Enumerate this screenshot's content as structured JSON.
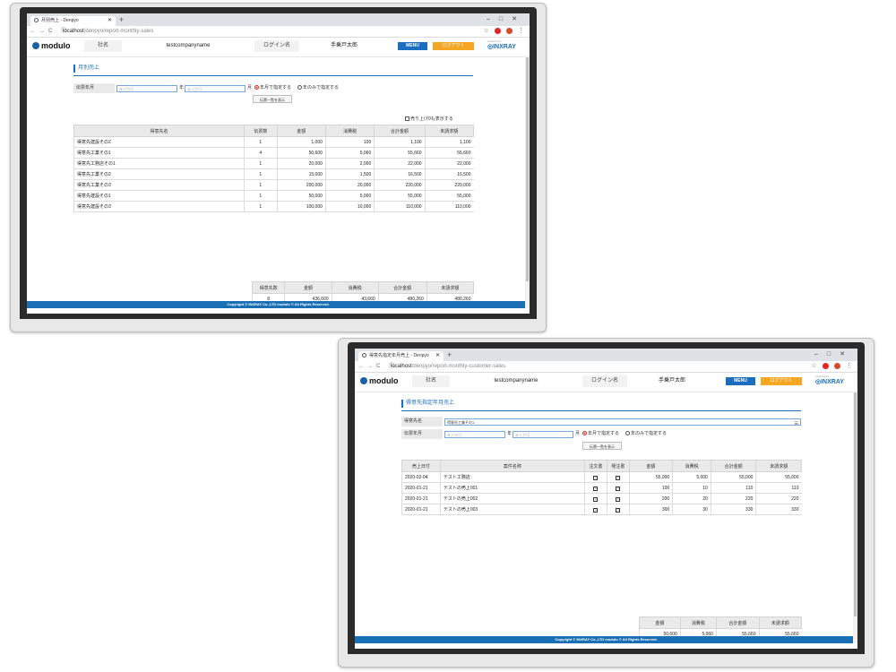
{
  "common": {
    "url_host": "localhost",
    "company_label": "社名",
    "company_value": "testcompanyname",
    "login_label": "ログイン名",
    "login_value": "手乗戸太郎",
    "menu_label": "MENU",
    "logout_label": "ログアウト",
    "brand": "modulo",
    "partner_brand": "INXRAY",
    "partner_powered": "powered by",
    "new_tab": "+",
    "footer": "Copyright © INXRAY Co.,LTD modulo © All Rights Reserved."
  },
  "monthly": {
    "tab_title": "月別売上 - Denpyo",
    "url_path": "/denpyo/report-monthly-sales",
    "page_title": "月別売上",
    "period_label": "伝票年月",
    "year_placeholder": "未入力可",
    "month_placeholder": "未入力可",
    "year_suffix": "年",
    "month_suffix": "月",
    "radio_ym": "年月で指定する",
    "radio_y": "年のみで指定する",
    "show_button": "伝票一覧を表示",
    "checkbox_label": "売り上げ0も表示する",
    "table_headers": [
      "得意先名",
      "伝票数",
      "金額",
      "消費税",
      "合計金額",
      "未請求額"
    ],
    "rows": [
      [
        "得意先建設その2",
        "1",
        "1,000",
        "100",
        "1,100",
        "1,100"
      ],
      [
        "得意先工業その1",
        "4",
        "50,600",
        "5,060",
        "55,660",
        "55,660"
      ],
      [
        "得意先工務店その1",
        "1",
        "20,000",
        "2,000",
        "22,000",
        "22,000"
      ],
      [
        "得意先工業その2",
        "1",
        "15,000",
        "1,500",
        "16,500",
        "16,500"
      ],
      [
        "得意先工業その3",
        "1",
        "200,000",
        "20,000",
        "220,000",
        "220,000"
      ],
      [
        "得意先建設その1",
        "1",
        "50,000",
        "5,000",
        "55,000",
        "55,000"
      ],
      [
        "得意先建設その3",
        "1",
        "100,000",
        "10,000",
        "110,000",
        "110,000"
      ]
    ],
    "summary_headers": [
      "得意先数",
      "金額",
      "消費税",
      "合計金額",
      "未請求額"
    ],
    "summary_values": [
      "8",
      "436,600",
      "43,660",
      "480,260",
      "480,260"
    ]
  },
  "customer": {
    "tab_title": "得意先指定年月売上 - Denpyo",
    "url_path": "/denpyo/report-monthly-customer-sales",
    "page_title": "得意先指定年月売上",
    "customer_label": "得意先名",
    "customer_value": "得意先工業その1",
    "period_label": "伝票年月",
    "year_placeholder": "未入力可",
    "month_placeholder": "未入力可",
    "year_suffix": "年",
    "month_suffix": "月",
    "radio_ym": "年月で指定する",
    "radio_y": "年のみで指定する",
    "show_button": "伝票一覧を表示",
    "table_headers": [
      "売上日付",
      "案件名称",
      "注文書",
      "発注書",
      "金額",
      "消費税",
      "合計金額",
      "未請求額"
    ],
    "rows": [
      [
        "2020-02-04",
        "テスト工務店",
        "55,000",
        "5,000",
        "55,000",
        "55,000"
      ],
      [
        "2020-01-21",
        "テストの売上001",
        "100",
        "10",
        "110",
        "110"
      ],
      [
        "2020-01-21",
        "テストの売上002",
        "200",
        "20",
        "220",
        "220"
      ],
      [
        "2020-01-21",
        "テストの売上003",
        "300",
        "30",
        "330",
        "330"
      ]
    ],
    "summary_headers": [
      "金額",
      "消費税",
      "合計金額",
      "未請求額"
    ],
    "summary_values": [
      "50,600",
      "5,060",
      "55,660",
      "55,660"
    ]
  }
}
